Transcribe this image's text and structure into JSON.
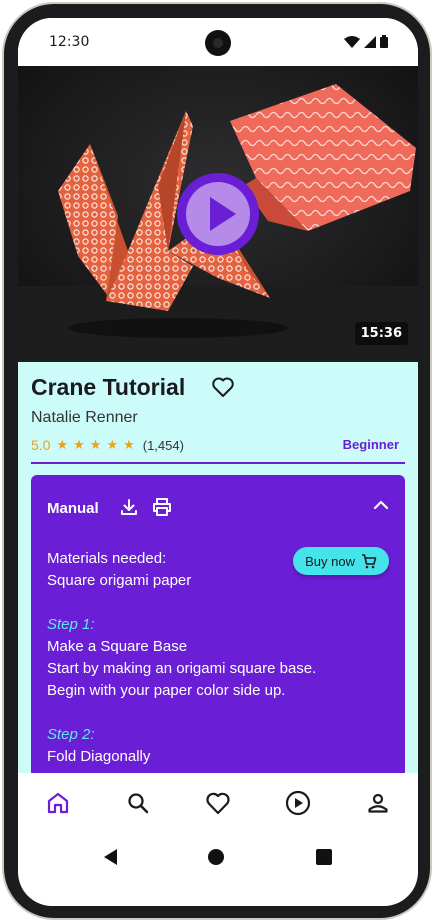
{
  "status_bar": {
    "time": "12:30"
  },
  "video": {
    "duration": "15:36",
    "image": "origami-crane-photo"
  },
  "tutorial": {
    "title": "Crane Tutorial",
    "author": "Natalie Renner",
    "rating": "5.0",
    "stars": 5,
    "review_count": "(1,454)",
    "level": "Beginner"
  },
  "manual": {
    "title": "Manual",
    "buy_label": "Buy now",
    "materials_heading": "Materials needed:",
    "materials_item": "Square origami paper",
    "steps": [
      {
        "label": "Step 1:",
        "title": "Make a Square Base",
        "lines": [
          "Start by making an origami square base.",
          "Begin with your paper color side up."
        ]
      },
      {
        "label": "Step 2:",
        "title": "Fold Diagonally",
        "lines": []
      }
    ]
  },
  "bottom_nav": {
    "items": [
      {
        "name": "home",
        "icon": "home-icon",
        "active": true
      },
      {
        "name": "search",
        "icon": "search-icon",
        "active": false
      },
      {
        "name": "favorites",
        "icon": "heart-icon",
        "active": false
      },
      {
        "name": "videos",
        "icon": "play-circle-icon",
        "active": false
      },
      {
        "name": "profile",
        "icon": "person-icon",
        "active": false
      }
    ]
  },
  "colors": {
    "accent": "#6a1fd6",
    "info_bg": "#ccfcf9",
    "step_label": "#5ee8ef",
    "buy_button": "#45e3ea",
    "star": "#e9a21f"
  }
}
